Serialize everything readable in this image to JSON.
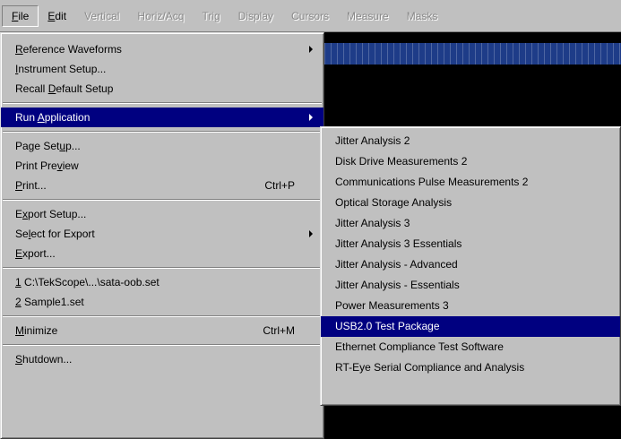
{
  "menubar": {
    "items": [
      {
        "label": "File",
        "mnemonic": "F",
        "rest": "ile"
      },
      {
        "label": "Edit",
        "mnemonic": "E",
        "rest": "dit"
      },
      {
        "label": "Vertical"
      },
      {
        "label": "Horiz/Acq"
      },
      {
        "label": "Trig"
      },
      {
        "label": "Display"
      },
      {
        "label": "Cursors"
      },
      {
        "label": "Measure"
      },
      {
        "label": "Masks"
      }
    ]
  },
  "file_menu": {
    "reference_waveforms": {
      "pre": "",
      "key": "R",
      "post": "eference Waveforms"
    },
    "instrument_setup": {
      "pre": "",
      "key": "I",
      "post": "nstrument Setup..."
    },
    "recall_default": {
      "pre": "Recall ",
      "key": "D",
      "post": "efault Setup"
    },
    "run_application": {
      "pre": "Run ",
      "key": "A",
      "post": "pplication"
    },
    "page_setup": {
      "pre": "Page Set",
      "key": "u",
      "post": "p..."
    },
    "print_preview": {
      "pre": "Print Pre",
      "key": "v",
      "post": "iew"
    },
    "print": {
      "pre": "",
      "key": "P",
      "post": "rint...",
      "shortcut": "Ctrl+P"
    },
    "export_setup": {
      "pre": "E",
      "key": "x",
      "post": "port Setup..."
    },
    "select_for_export": {
      "pre": "Se",
      "key": "l",
      "post": "ect for Export"
    },
    "export": {
      "pre": "",
      "key": "E",
      "post": "xport..."
    },
    "recent_1": {
      "pre": "",
      "key": "1",
      "post": " C:\\TekScope\\...\\sata-oob.set"
    },
    "recent_2": {
      "pre": "",
      "key": "2",
      "post": " Sample1.set"
    },
    "minimize": {
      "pre": "",
      "key": "M",
      "post": "inimize",
      "shortcut": "Ctrl+M"
    },
    "shutdown": {
      "pre": "",
      "key": "S",
      "post": "hutdown..."
    }
  },
  "run_application_submenu": {
    "items": [
      "Jitter Analysis 2",
      "Disk Drive Measurements 2",
      "Communications Pulse Measurements 2",
      "Optical Storage Analysis",
      "Jitter Analysis 3",
      "Jitter Analysis 3 Essentials",
      "Jitter Analysis - Advanced",
      "Jitter Analysis - Essentials",
      "Power Measurements 3",
      "USB2.0 Test Package",
      "Ethernet Compliance Test Software",
      "RT-Eye Serial Compliance and Analysis"
    ],
    "highlighted": "USB2.0 Test Package"
  },
  "colors": {
    "menu_bg": "#c0c0c0",
    "highlight": "#000080",
    "screen_bg": "#000000",
    "disabled_text": "#8a8a8a"
  }
}
